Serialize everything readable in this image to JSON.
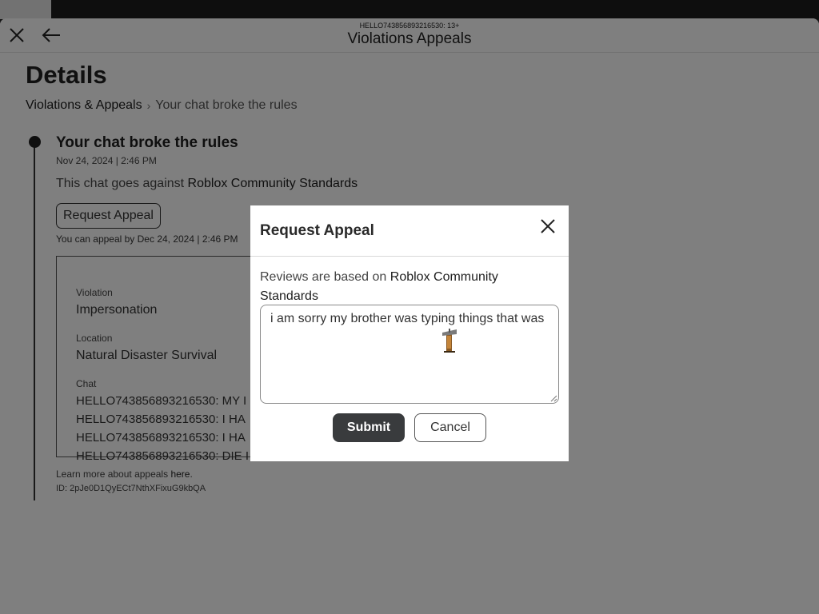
{
  "window": {
    "user_line": "HELLO743856893216530: 13+",
    "title": "Violations Appeals"
  },
  "page": {
    "title": "Details",
    "breadcrumb": {
      "root": "Violations & Appeals",
      "separator": "›",
      "current": "Your chat broke the rules"
    },
    "event": {
      "title": "Your chat broke the rules",
      "date": "Nov 24, 2024 | 2:46 PM",
      "description_prefix": "This chat goes against ",
      "description_link": "Roblox Community Standards",
      "request_button": "Request Appeal",
      "deadline": "You can appeal by Dec 24, 2024 | 2:46 PM"
    },
    "details": {
      "violation_label": "Violation",
      "violation_value": "Impersonation",
      "location_label": "Location",
      "location_value": "Natural Disaster Survival",
      "chat_label": "Chat",
      "chat_lines": [
        "HELLO743856893216530: MY I",
        "HELLO743856893216530: I HA",
        "HELLO743856893216530: I HA",
        "HELLO743856893216530: DIE I"
      ]
    },
    "learn_more_prefix": "Learn more about appeals ",
    "learn_more_link": "here",
    "learn_more_suffix": ".",
    "id_line": "ID: 2pJe0D1QyECt7NthXFixuG9kbQA"
  },
  "modal": {
    "title": "Request Appeal",
    "note_prefix": "Reviews are based on ",
    "note_link": "Roblox Community Standards",
    "textarea_value": "i am sorry my brother was typing things that was ",
    "submit_label": "Submit",
    "cancel_label": "Cancel"
  },
  "icons": {
    "close": "close-x-icon",
    "back": "arrow-left-icon",
    "chevron": "chevron-right-icon",
    "cursor": "mouse-cursor-icon"
  },
  "colors": {
    "dark_button": "#393b3d",
    "overlay": "rgba(0,0,0,0.5)",
    "text_primary": "#1e1e1e"
  }
}
